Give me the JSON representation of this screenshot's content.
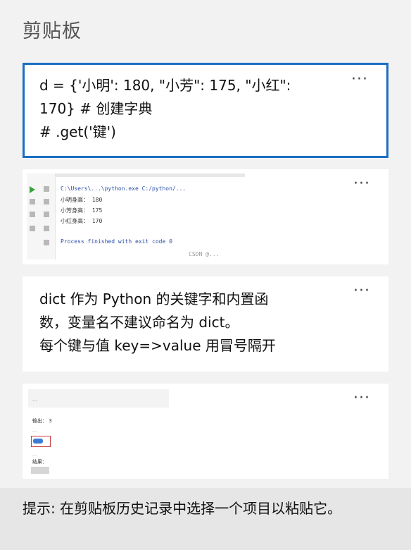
{
  "header": {
    "title": "剪贴板"
  },
  "items": [
    {
      "type": "text",
      "selected": true,
      "text": "d = {'小明': 180, \"小芳\": 175, \"小红\":\n170} # 创建字典\n# .get('键')",
      "more_label": "···"
    },
    {
      "type": "image",
      "selected": false,
      "more_label": "···",
      "thumb": {
        "path_line": "C:\\Users\\...\\python.exe C:/python/...",
        "output_lines": [
          "小明身高：  180",
          "小芳身高：  175",
          "小红身高：  170"
        ],
        "exit_line": "Process finished with exit code 0",
        "watermark": "CSDN @..."
      }
    },
    {
      "type": "text",
      "selected": false,
      "text": "dict 作为 Python 的关键字和内置函\n数，变量名不建议命名为 dict。\n每个键与值 key=>value 用冒号隔开",
      "more_label": "···"
    },
    {
      "type": "image",
      "selected": false,
      "more_label": "···",
      "thumb": {
        "header_line": "...",
        "lines": [
          "输出：  3",
          "...",
          "...",
          "结果："
        ]
      }
    }
  ],
  "footer": {
    "hint": "提示: 在剪贴板历史记录中选择一个项目以粘贴它。"
  },
  "colors": {
    "accent": "#1b6ec2",
    "background": "#f2f2f2",
    "card": "#ffffff",
    "footer": "#e6e6e6"
  }
}
